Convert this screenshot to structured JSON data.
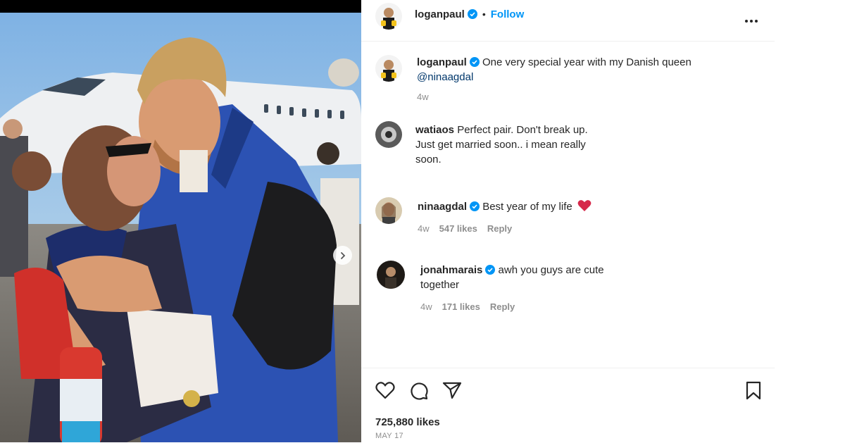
{
  "header": {
    "username": "loganpaul",
    "follow_label": "Follow",
    "separator": "•"
  },
  "caption": {
    "username": "loganpaul",
    "text": "One very special year with my Danish queen",
    "mention": "@ninaagdal",
    "time": "4w"
  },
  "comments": [
    {
      "username": "watiaos",
      "text": "Perfect pair. Don't break up. Just get married soon.. i mean really soon.",
      "verified": false
    },
    {
      "username": "ninaagdal",
      "text": "Best year of my life",
      "verified": true,
      "time": "4w",
      "likes": "547 likes",
      "reply": "Reply",
      "emoji": "red-heart"
    },
    {
      "username": "jonahmarais",
      "text": "awh you guys are cute together",
      "verified": true,
      "time": "4w",
      "likes": "171 likes",
      "reply": "Reply"
    }
  ],
  "footer": {
    "likes": "725,880 likes",
    "date": "MAY 17"
  },
  "colors": {
    "accent": "#0095f6",
    "verified": "#0095f6",
    "heart": "#e0245e"
  }
}
